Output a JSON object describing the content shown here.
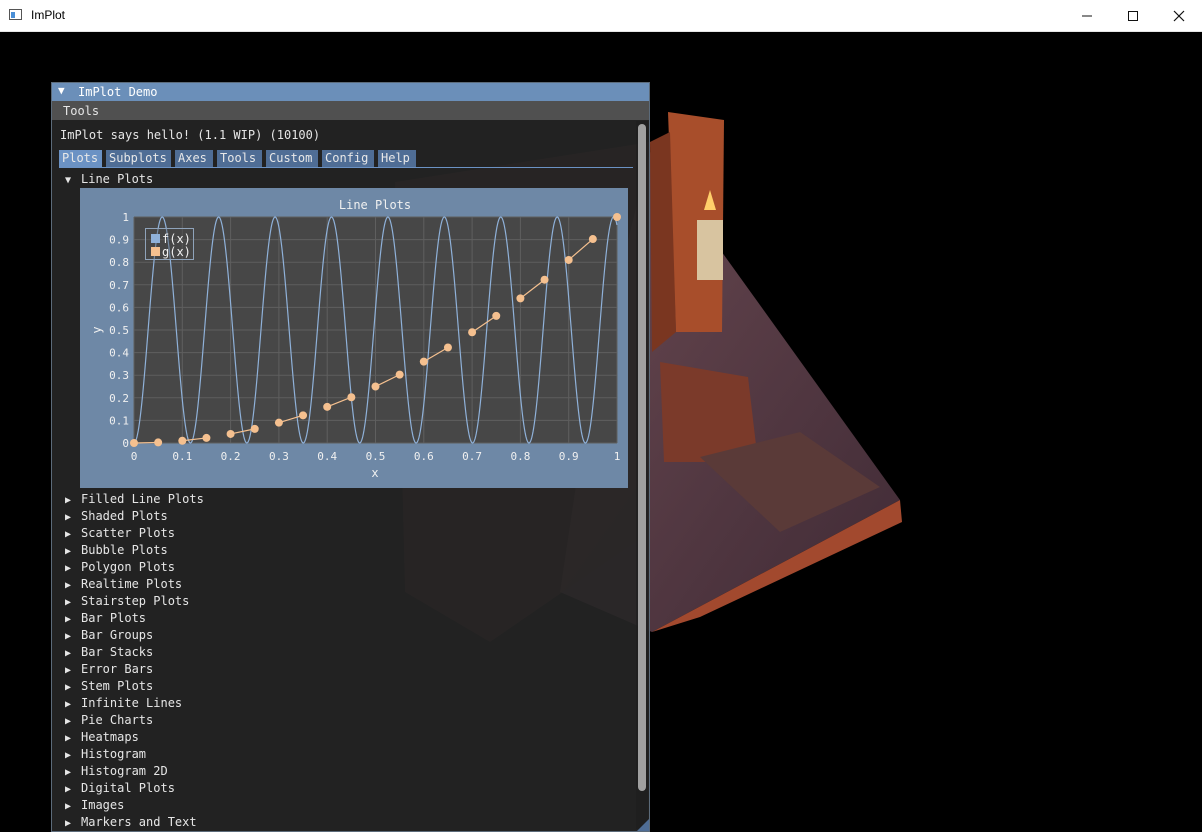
{
  "window": {
    "title": "ImPlot"
  },
  "demo": {
    "title": "ImPlot Demo",
    "menu": [
      "Tools"
    ],
    "hello": "ImPlot says hello! (1.1 WIP) (10100)",
    "tabs": [
      "Plots",
      "Subplots",
      "Axes",
      "Tools",
      "Custom",
      "Config",
      "Help"
    ],
    "active_tab": "Plots",
    "open_section": "Line Plots",
    "sections": [
      "Filled Line Plots",
      "Shaded Plots",
      "Scatter Plots",
      "Bubble Plots",
      "Polygon Plots",
      "Realtime Plots",
      "Stairstep Plots",
      "Bar Plots",
      "Bar Groups",
      "Bar Stacks",
      "Error Bars",
      "Stem Plots",
      "Infinite Lines",
      "Pie Charts",
      "Heatmaps",
      "Histogram",
      "Histogram 2D",
      "Digital Plots",
      "Images",
      "Markers and Text"
    ]
  },
  "icons": {
    "collapse": "triangle-down-icon",
    "expand": "triangle-right-icon",
    "minimize": "minimize-icon",
    "maximize": "maximize-icon",
    "close": "close-icon"
  },
  "colors": {
    "title_bar": "#6b8fb9",
    "tab": "#4f6d95",
    "tab_active": "#6b92c4",
    "plot_frame": "#6e88a6",
    "plot_bg": "#474747",
    "series_f": "#8fb1d9",
    "series_g": "#f5c08f"
  },
  "chart_data": {
    "type": "line",
    "title": "Line Plots",
    "xlabel": "x",
    "ylabel": "y",
    "xlim": [
      0,
      1
    ],
    "ylim": [
      0,
      1
    ],
    "x_ticks": [
      "0",
      "0.1",
      "0.2",
      "0.3",
      "0.4",
      "0.5",
      "0.6",
      "0.7",
      "0.8",
      "0.9",
      "1"
    ],
    "y_ticks": [
      "0",
      "0.1",
      "0.2",
      "0.3",
      "0.4",
      "0.5",
      "0.6",
      "0.7",
      "0.8",
      "0.9",
      "1"
    ],
    "grid": true,
    "legend_position": "top-left",
    "series": [
      {
        "name": "f(x)",
        "kind": "line",
        "oscillation_cycles": 8,
        "y_range": [
          0,
          1
        ]
      },
      {
        "name": "g(x)",
        "kind": "line-with-markers",
        "x": [
          0,
          0.05,
          0.1,
          0.15,
          0.2,
          0.25,
          0.3,
          0.35,
          0.4,
          0.45,
          0.5,
          0.55,
          0.6,
          0.65,
          0.7,
          0.75,
          0.8,
          0.85,
          0.9,
          0.95,
          1.0
        ],
        "y": [
          0,
          0.0025,
          0.01,
          0.0225,
          0.04,
          0.0625,
          0.09,
          0.1225,
          0.16,
          0.2025,
          0.25,
          0.3025,
          0.36,
          0.4225,
          0.49,
          0.5625,
          0.64,
          0.7225,
          0.81,
          0.9025,
          1.0
        ],
        "pairs_connected": true
      }
    ]
  }
}
